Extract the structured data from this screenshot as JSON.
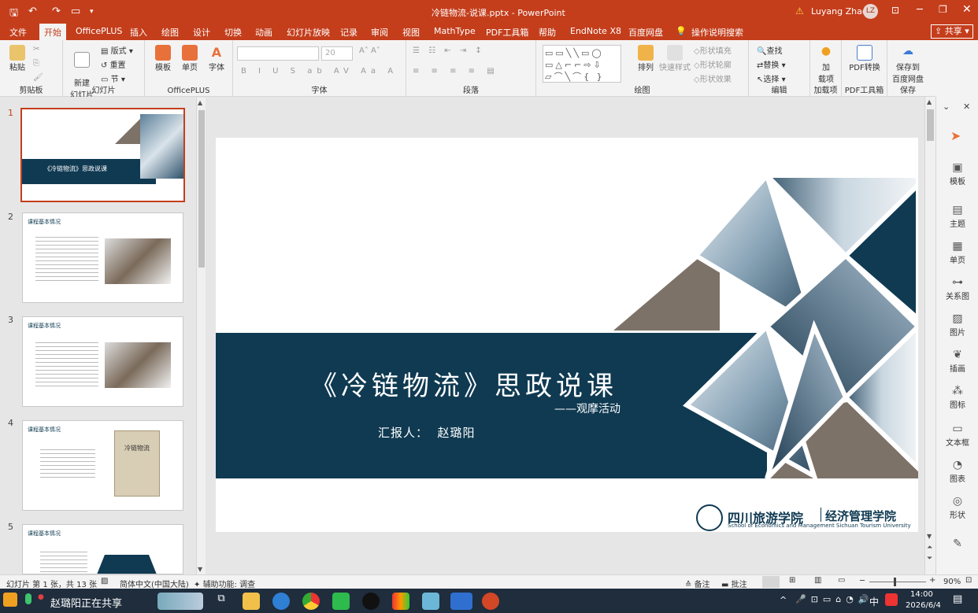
{
  "window": {
    "title": "冷链物流-说课.pptx  -  PowerPoint",
    "user_name": "Luyang Zhao",
    "user_initials": "LZ",
    "share_label": "共享"
  },
  "tabs": [
    "文件",
    "开始",
    "OfficePLUS",
    "插入",
    "绘图",
    "设计",
    "切换",
    "动画",
    "幻灯片放映",
    "记录",
    "审阅",
    "视图",
    "MathType",
    "PDF工具箱",
    "帮助",
    "EndNote X8",
    "百度网盘"
  ],
  "active_tab": "开始",
  "tell_me": "操作说明搜索",
  "ribbon": {
    "clipboard": {
      "paste": "粘贴",
      "group": "剪贴板"
    },
    "slides": {
      "new_slide": "新建\n幻灯片",
      "layout": "版式",
      "reset": "重置",
      "section": "节",
      "group": "幻灯片"
    },
    "officeplus": {
      "template": "模板",
      "single": "单页",
      "font": "字体",
      "group": "OfficePLUS"
    },
    "font": {
      "size": "20",
      "group": "字体"
    },
    "paragraph": {
      "group": "段落"
    },
    "drawing": {
      "arrange": "排列",
      "quick_styles": "快速样式",
      "fill": "形状填充",
      "outline": "形状轮廓",
      "effects": "形状效果",
      "group": "绘图"
    },
    "editing": {
      "find": "查找",
      "replace": "替换",
      "select": "选择",
      "group": "编辑"
    },
    "addins": {
      "load": "加\n载项",
      "group": "加载项"
    },
    "pdf": {
      "convert": "PDF转换",
      "group": "PDF工具箱"
    },
    "save": {
      "save_baidu": "保存到\n百度网盘",
      "group": "保存"
    }
  },
  "thumbnails": [
    {
      "num": "1",
      "title": "《冷链物流》思政说课"
    },
    {
      "num": "2",
      "title": "课程基本情况"
    },
    {
      "num": "3",
      "title": "课程基本情况"
    },
    {
      "num": "4",
      "title": "课程基本情况",
      "book": "冷链物流"
    },
    {
      "num": "5",
      "title": "课程基本情况"
    }
  ],
  "slide": {
    "title": "《冷链物流》思政说课",
    "subtitle": "——观摩活动",
    "presenter": "汇报人：  赵璐阳",
    "school_cn": "四川旅游学院",
    "dept_cn": "经济管理学院",
    "school_en": "School of Economics and Management Sichuan Tourism University"
  },
  "right_pane": [
    "模板",
    "主题",
    "单页",
    "关系图",
    "图片",
    "插画",
    "图标",
    "文本框",
    "图表",
    "形状"
  ],
  "status": {
    "slide_info": "幻灯片 第 1 张，共 13 张",
    "language": "简体中文(中国大陆)",
    "accessibility": "辅助功能: 调查",
    "notes": "备注",
    "comments": "批注",
    "zoom": "90%"
  },
  "taskbar": {
    "sharing": "赵璐阳正在共享",
    "time": "14:00",
    "date": "2026/6/4",
    "ime": "中"
  },
  "colors": {
    "accent": "#c43e1c",
    "slide_navy": "#0f3a52",
    "slide_taupe": "#7d7268"
  }
}
